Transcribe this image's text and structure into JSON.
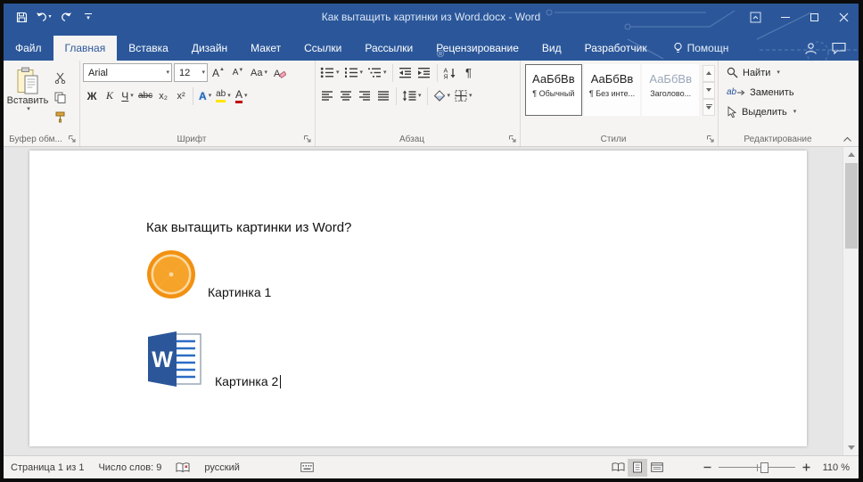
{
  "window": {
    "title": "Как вытащить картинки из Word.docx - Word"
  },
  "watermark": "®",
  "tabs": [
    {
      "label": "Файл"
    },
    {
      "label": "Главная"
    },
    {
      "label": "Вставка"
    },
    {
      "label": "Дизайн"
    },
    {
      "label": "Макет"
    },
    {
      "label": "Ссылки"
    },
    {
      "label": "Рассылки"
    },
    {
      "label": "Рецензирование"
    },
    {
      "label": "Вид"
    },
    {
      "label": "Разработчик"
    }
  ],
  "assistant": {
    "label": "Помощн"
  },
  "ribbon": {
    "clipboard": {
      "paste": "Вставить",
      "label": "Буфер обм..."
    },
    "font": {
      "name": "Arial",
      "size": "12",
      "grow": "А",
      "shrink": "А",
      "case": "Aa",
      "bold": "Ж",
      "italic": "К",
      "underline": "Ч",
      "strike": "abc",
      "sub": "x₂",
      "sup": "x²",
      "effects": "А",
      "highlight": "ab",
      "color": "А",
      "label": "Шрифт"
    },
    "paragraph": {
      "sort_a": "А",
      "sort_z": "Я",
      "pilcrow": "¶",
      "label": "Абзац"
    },
    "styles": {
      "label": "Стили",
      "items": [
        {
          "sample": "АаБбВв",
          "name": "¶ Обычный"
        },
        {
          "sample": "АаБбВв",
          "name": "¶ Без инте..."
        },
        {
          "sample": "АаБбВв",
          "name": "Заголово..."
        }
      ]
    },
    "editing": {
      "find": "Найти",
      "replace": "Заменить",
      "select": "Выделить",
      "replace_icon": "ab",
      "label": "Редактирование"
    }
  },
  "document": {
    "heading": "Как вытащить картинки из Word?",
    "captions": [
      "Картинка 1",
      "Картинка 2"
    ],
    "word_logo_letter": "W"
  },
  "status": {
    "page": "Страница 1 из 1",
    "words": "Число слов: 9",
    "language": "русский",
    "zoom": "110 %"
  },
  "colors": {
    "accent": "#2b579a"
  }
}
